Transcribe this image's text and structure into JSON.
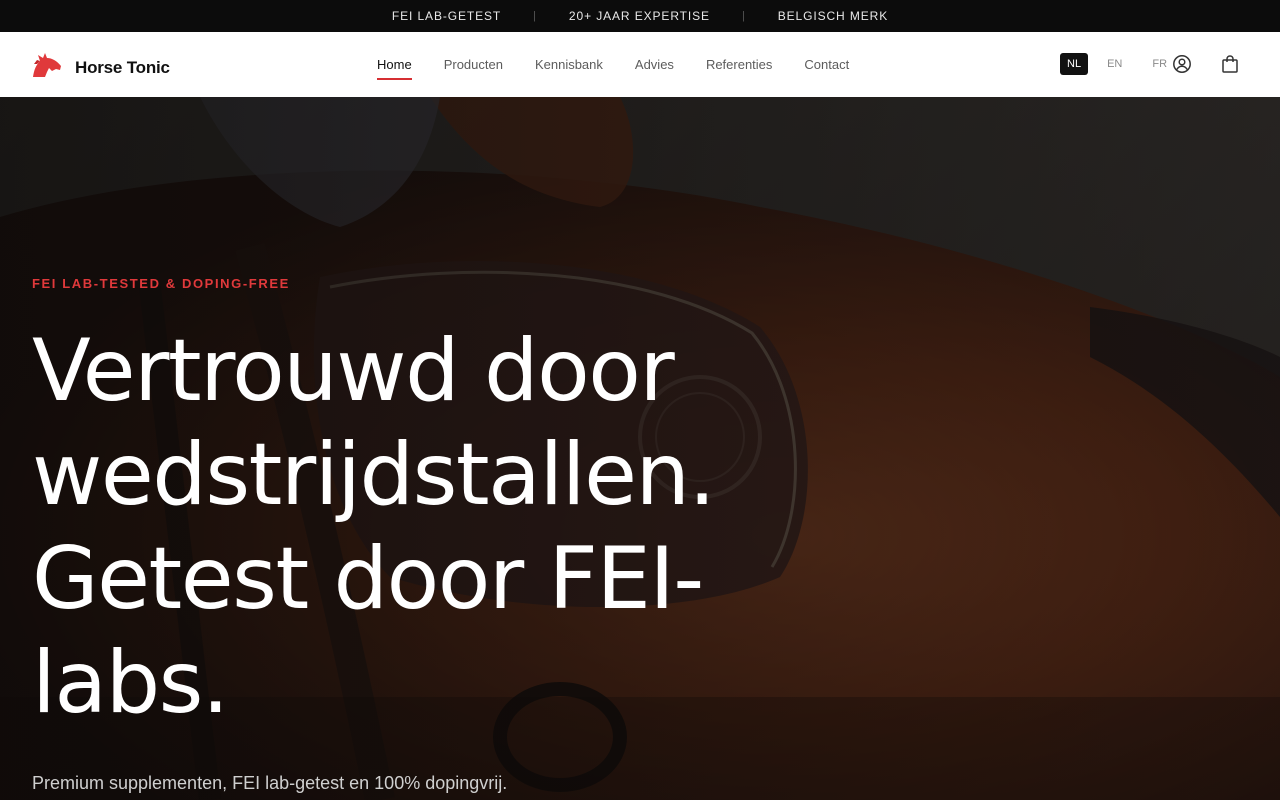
{
  "topbar": {
    "items": [
      "FEI LAB-GETEST",
      "20+ JAAR EXPERTISE",
      "BELGISCH MERK"
    ],
    "separator": "|"
  },
  "header": {
    "brand": "Horse Tonic",
    "logo_icon": "horse-head-logo",
    "nav": [
      {
        "label": "Home",
        "active": true
      },
      {
        "label": "Producten"
      },
      {
        "label": "Kennisbank"
      },
      {
        "label": "Advies"
      },
      {
        "label": "Referenties"
      },
      {
        "label": "Contact"
      }
    ],
    "languages": [
      {
        "label": "NL",
        "active": true
      },
      {
        "label": "EN"
      },
      {
        "label": "FR"
      }
    ],
    "icons": [
      "user-icon",
      "shopping-bag-icon"
    ]
  },
  "hero": {
    "eyebrow": "FEI LAB-TESTED & DOPING-FREE",
    "headline": "Vertrouwd door wedstrijdstallen. Getest door FEI-labs.",
    "subline": "Premium supplementen, FEI lab-getest en 100% dopingvrij."
  },
  "colors": {
    "accent": "#d62f33",
    "topbar_bg": "#0c0c0c",
    "header_bg": "#ffffff"
  }
}
